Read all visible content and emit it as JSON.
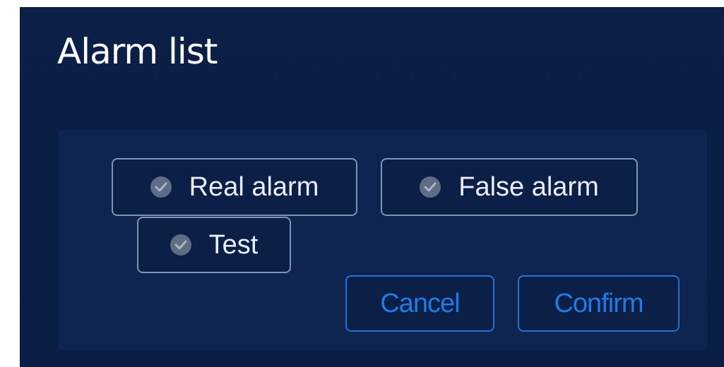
{
  "dialog": {
    "title": "Alarm list",
    "options": [
      {
        "label": "Real alarm",
        "icon": "check-circle-icon",
        "selected": false
      },
      {
        "label": "False alarm",
        "icon": "check-circle-icon",
        "selected": false
      },
      {
        "label": "Test",
        "icon": "check-circle-icon",
        "selected": false
      }
    ],
    "buttons": {
      "cancel_label": "Cancel",
      "confirm_label": "Confirm"
    }
  },
  "colors": {
    "background": "#0b1f47",
    "content_box": "#0f2550",
    "option_border": "#7f93b7",
    "option_text": "#e9eef7",
    "check_icon": "#5e6c84",
    "accent": "#1f73d6"
  }
}
